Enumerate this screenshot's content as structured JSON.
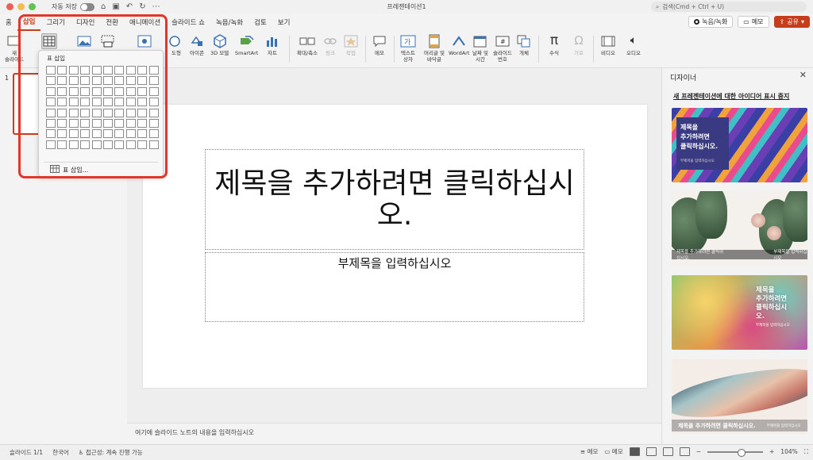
{
  "window": {
    "title": "프레젠테이션1",
    "autosave_label": "자동 저장",
    "search_placeholder": "검색(Cmd + Ctrl + U)"
  },
  "menu": {
    "tabs": [
      "홈",
      "삽입",
      "그리기",
      "디자인",
      "전환",
      "애니메이션",
      "슬라이드 쇼",
      "녹음/녹화",
      "검토",
      "보기"
    ],
    "active_tab": "삽입",
    "record_button": "녹음/녹화",
    "comment_button": "메모",
    "share_button": "공유"
  },
  "ribbon": {
    "new_slide": "새\n슬라이드",
    "shapes": "도형",
    "icons": "아이콘",
    "models3d": "3D 모델",
    "smartart": "SmartArt",
    "chart": "차트",
    "zoom": "확대/축소",
    "link": "링크",
    "action": "작업",
    "comment": "메모",
    "textbox": "텍스트\n상자",
    "header_footer": "머리글 및\n바닥글",
    "wordart": "WordArt",
    "datetime": "날짜 및\n시간",
    "slide_number": "슬라이드\n번호",
    "object": "개체",
    "equation": "수식",
    "symbol": "기호",
    "video": "비디오",
    "audio": "오디오"
  },
  "table_dropdown": {
    "title": "표 삽입",
    "insert_table": "표 삽입...",
    "grid_cols": 10,
    "grid_rows": 8
  },
  "thumbnails": {
    "slide_number": "1"
  },
  "slide": {
    "title_placeholder": "제목을 추가하려면 클릭하십시오.",
    "subtitle_placeholder": "부제목을 입력하십시오"
  },
  "notes": {
    "placeholder": "여기에 슬라이드 노트의 내용을 입력하십시오"
  },
  "designer": {
    "title": "디자이너",
    "stop_link": "새 프레젠테이션에 대한 아이디어 표시 중지",
    "card1_title": "제목을\n추가하려면\n클릭하십시오.",
    "card1_sub": "부제목을 입력하십시오",
    "card2_title": "제목을 추가하려면 클릭하십시오.",
    "card2_sub": "부제목을 입력하십시오",
    "card3_title": "제목을\n추가하려면\n클릭하십시\n오.",
    "card3_sub": "부제목을 입력하십시오",
    "card4_title": "제목을 추가하려면 클릭하십시오.",
    "card4_sub": "부제목을 입력하십시오"
  },
  "statusbar": {
    "slide_count": "슬라이드 1/1",
    "language": "한국어",
    "accessibility": "접근성: 계속 진행 가능",
    "notes": "메모",
    "comments": "메모",
    "zoom": "104%"
  },
  "colors": {
    "accent": "#c43e1c",
    "highlight": "#e1372b"
  }
}
